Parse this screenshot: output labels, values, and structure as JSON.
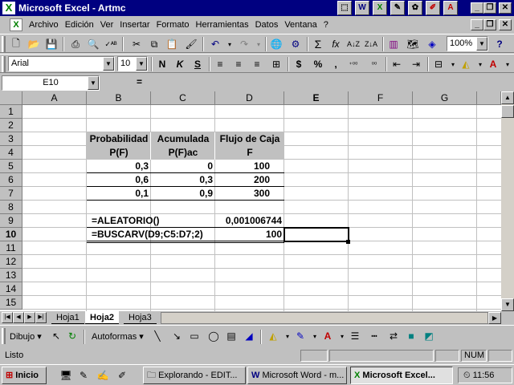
{
  "window": {
    "title": "Microsoft Excel - Artmc",
    "app_icon": "X",
    "minimize_glyph": "_",
    "restore_glyph": "❐",
    "close_glyph": "✕"
  },
  "menubar": {
    "items": [
      "Archivo",
      "Edición",
      "Ver",
      "Insertar",
      "Formato",
      "Herramientas",
      "Datos",
      "Ventana",
      "?"
    ]
  },
  "toolbar_standard": {
    "zoom": "100%"
  },
  "toolbar_format": {
    "font": "Arial",
    "size": "10",
    "bold": "N",
    "italic": "K",
    "underline": "S",
    "currency": "$",
    "percent": "%"
  },
  "formulabar": {
    "cell_ref": "E10",
    "equals": "=",
    "content": ""
  },
  "sheet": {
    "columns": [
      "A",
      "B",
      "C",
      "D",
      "E",
      "F",
      "G"
    ],
    "rows": [
      "1",
      "2",
      "3",
      "4",
      "5",
      "6",
      "7",
      "8",
      "9",
      "10",
      "11",
      "12",
      "13",
      "14",
      "15"
    ],
    "header_b3": "Probabilidad",
    "header_b4": "P(F)",
    "header_c3": "Acumulada",
    "header_c4": "P(F)ac",
    "header_d3": "Flujo de Caja",
    "header_d4": "F",
    "b5": "0,3",
    "c5": "0",
    "d5": "100",
    "b6": "0,6",
    "c6": "0,3",
    "d6": "200",
    "b7": "0,1",
    "c7": "0,9",
    "d7": "300",
    "b9": "=ALEATORIO()",
    "d9": "0,001006744",
    "b10": "=BUSCARV(D9;C5:D7;2)",
    "d10": "100"
  },
  "sheet_tabs": [
    "Hoja1",
    "Hoja2",
    "Hoja3"
  ],
  "active_tab": "Hoja2",
  "drawbar": {
    "dibujo": "Dibujo",
    "autoformas": "Autoformas"
  },
  "statusbar": {
    "status": "Listo",
    "num": "NUM"
  },
  "taskbar": {
    "start": "Inicio",
    "tasks": [
      "Explorando - EDIT...",
      "Microsoft Word - m...",
      "Microsoft Excel..."
    ],
    "clock": "11:56"
  },
  "colors": {
    "titlebar": "#000080",
    "header_fill": "#c0c0c0"
  }
}
